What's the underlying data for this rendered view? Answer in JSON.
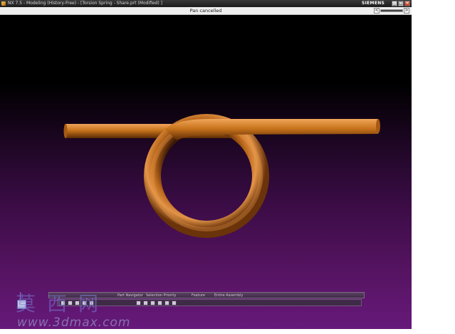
{
  "window": {
    "title": "NX 7.5 - Modeling (History-Free) - [Torsion Spring - Share.prt (Modified) ]",
    "brand": "SIEMENS",
    "controls": {
      "minimize": "_",
      "maximize": "□",
      "close": "×"
    }
  },
  "status": {
    "message": "Pan cancelled",
    "scroll_left": "<",
    "scroll_right": ">"
  },
  "viewport": {
    "background_top": "#000000",
    "background_bottom": "#66197a",
    "model_color": "#c8741c",
    "model_highlight": "#f0a55a",
    "model_shadow": "#5a2a05"
  },
  "quick_toolbar": {
    "items": [
      "Part Navigator",
      "Selection Priority",
      "Feature",
      "Entire Assembly"
    ]
  },
  "watermark": {
    "chinese": "莫西网",
    "url": "www.3dmax.com"
  }
}
